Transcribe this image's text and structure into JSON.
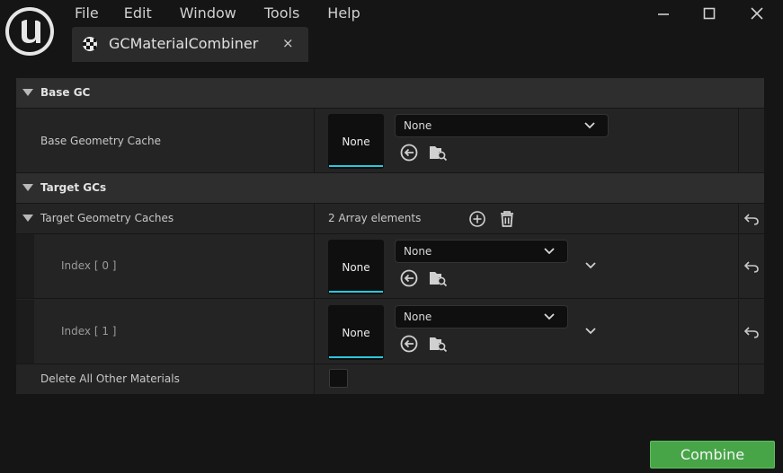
{
  "menu": {
    "file": "File",
    "edit": "Edit",
    "window": "Window",
    "tools": "Tools",
    "help": "Help"
  },
  "tab": {
    "title": "GCMaterialCombiner",
    "close": "×"
  },
  "categories": {
    "base": "Base GC",
    "targets": "Target GCs"
  },
  "base_gc": {
    "label": "Base Geometry Cache",
    "thumb": "None",
    "combo": "None"
  },
  "target_gcs": {
    "label": "Target Geometry Caches",
    "count": "2 Array elements",
    "items": [
      {
        "label": "Index [ 0 ]",
        "thumb": "None",
        "combo": "None"
      },
      {
        "label": "Index [ 1 ]",
        "thumb": "None",
        "combo": "None"
      }
    ]
  },
  "delete_all": {
    "label": "Delete All Other Materials",
    "checked": false
  },
  "combine_label": "Combine",
  "colors": {
    "accent_cyan": "#29c8dc",
    "combine_green": "#47a548",
    "background": "#151515",
    "panel": "#242424"
  }
}
